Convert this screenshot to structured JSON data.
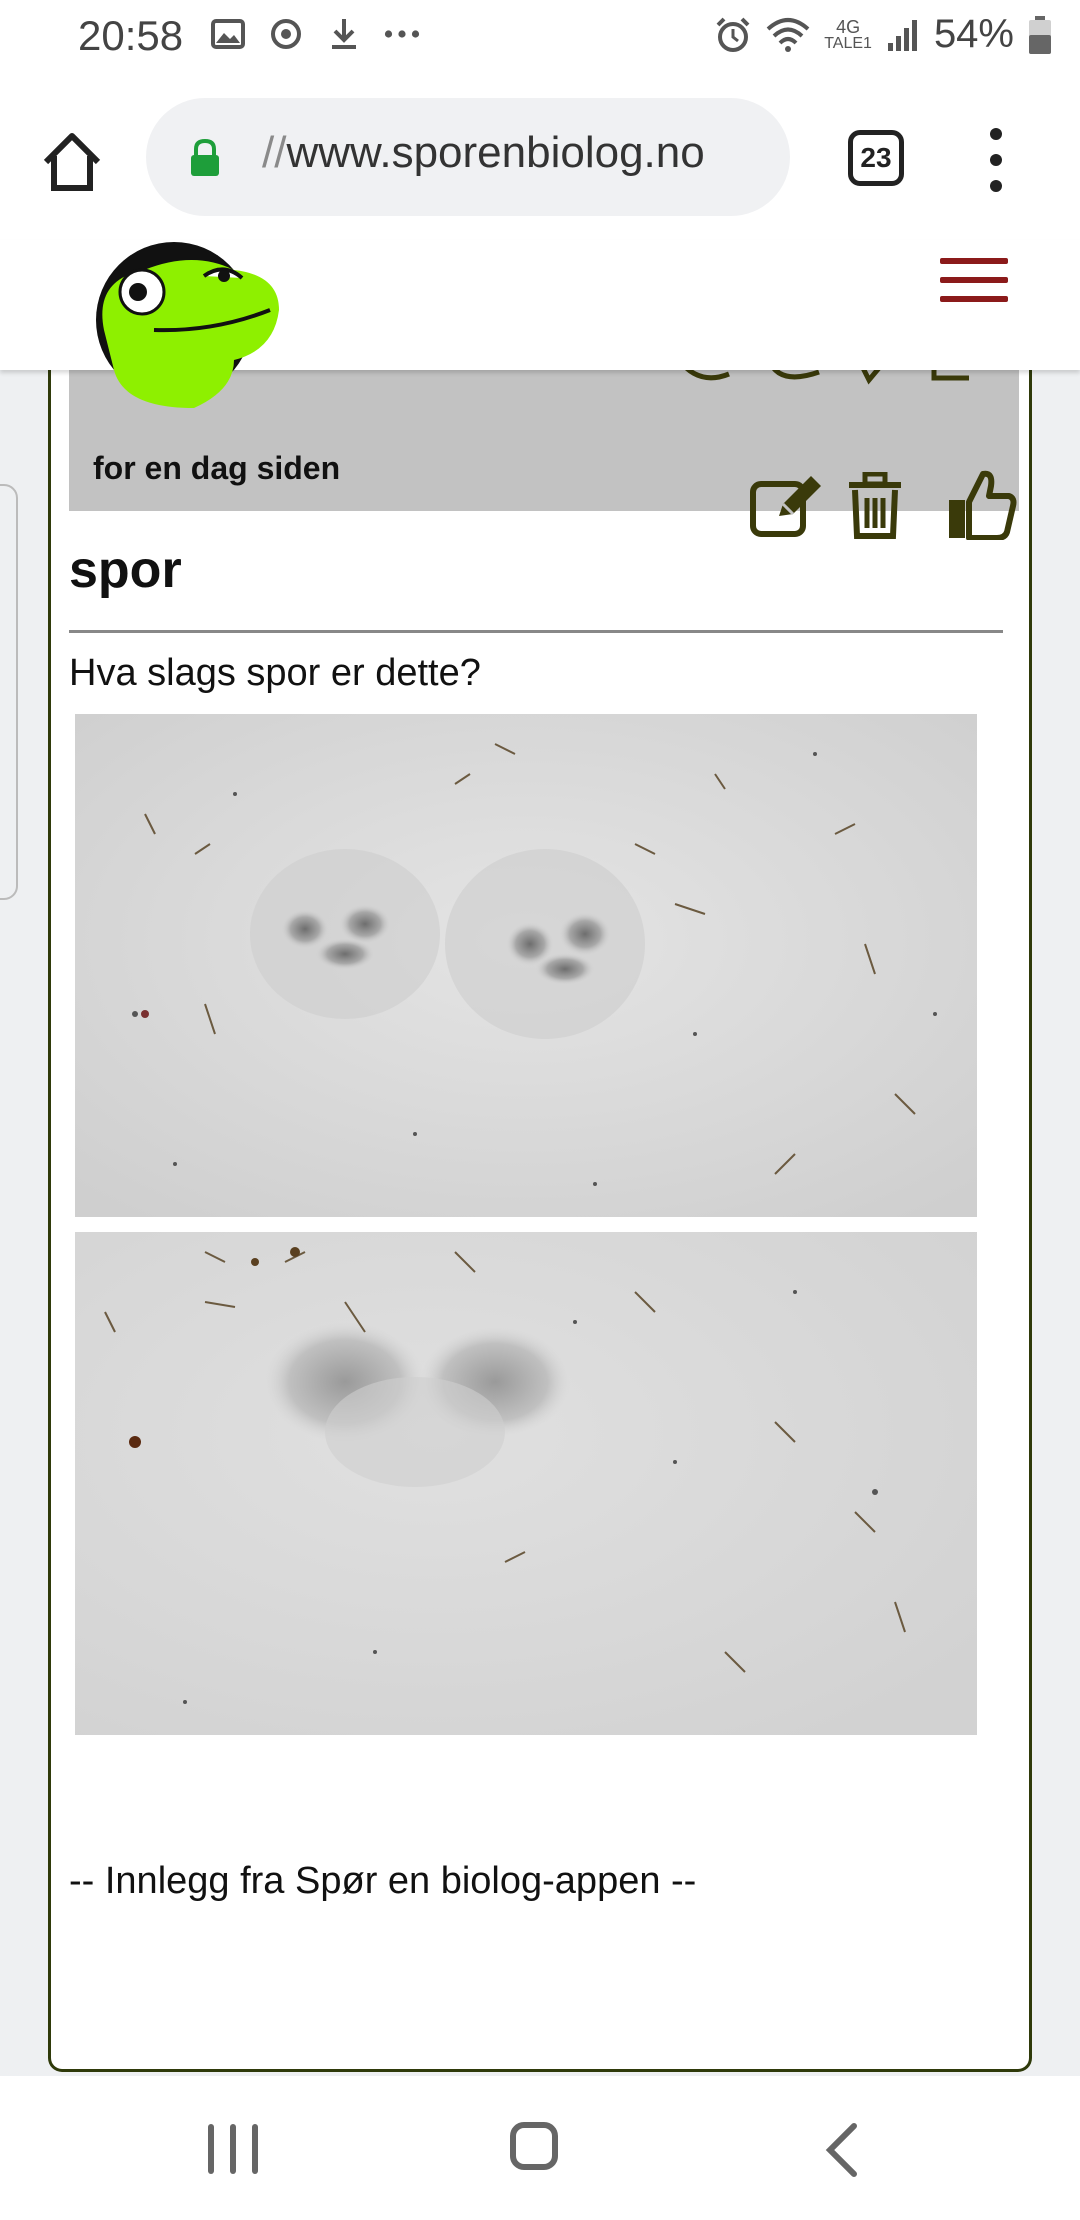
{
  "status_bar": {
    "time": "20:58",
    "left_icons": [
      "image-icon",
      "sync-icon",
      "download-icon",
      "more-notifications-icon"
    ],
    "right_icons": [
      "alarm-icon",
      "wifi-icon",
      "network-4g-icon",
      "signal-icon",
      "battery-icon"
    ],
    "network_label": "4G",
    "carrier_label": "TALE1",
    "battery": "54%"
  },
  "browser": {
    "url_prefix": "//",
    "url_host": "www.sporenbiolog.no",
    "tab_count": "23",
    "lock_color": "#1e9e3a"
  },
  "site": {
    "menu_color": "#8b1a1a",
    "logo_color": "#8ef000"
  },
  "post": {
    "author_line": "for en dag siden",
    "title": "spor",
    "body": "Hva slags spor er dette?",
    "footer": "-- Innlegg fra Spør en biolog-appen --",
    "actions": [
      "edit-icon",
      "trash-icon",
      "thumbs-up-icon"
    ],
    "accent_color": "#3a3a0a"
  },
  "nav_bar": {
    "buttons": [
      "recent-apps",
      "home",
      "back"
    ]
  }
}
